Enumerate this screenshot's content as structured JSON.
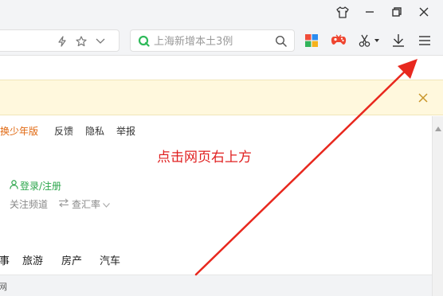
{
  "search": {
    "placeholder": "上海新增本土3例"
  },
  "page_links": {
    "switch_youth": "切换少年版",
    "feedback": "反馈",
    "privacy": "隐私",
    "report": "举报"
  },
  "annotation": {
    "text": "点击网页右上方"
  },
  "account": {
    "login": "登录/注册",
    "follow_channel": "关注频道",
    "exchange_rate": "查汇率"
  },
  "nav": {
    "items": [
      "军事",
      "旅游",
      "房产",
      "汽车"
    ]
  },
  "bottom": {
    "text": "网"
  },
  "colors": {
    "annotation_red": "#e02020",
    "arrow_red": "#e8281e",
    "login_green": "#2aa54a",
    "youth_orange": "#e0670f",
    "notice_bg": "#fff8dd"
  },
  "icons": {
    "titlebar": [
      "shirt-icon",
      "minimize-icon",
      "restore-icon",
      "close-icon"
    ],
    "address": [
      "lightning-icon",
      "star-icon",
      "chevron-down-icon"
    ],
    "toolbar": [
      "apps-grid-icon",
      "game-controller-icon",
      "scissors-icon",
      "download-icon",
      "menu-icon"
    ]
  }
}
